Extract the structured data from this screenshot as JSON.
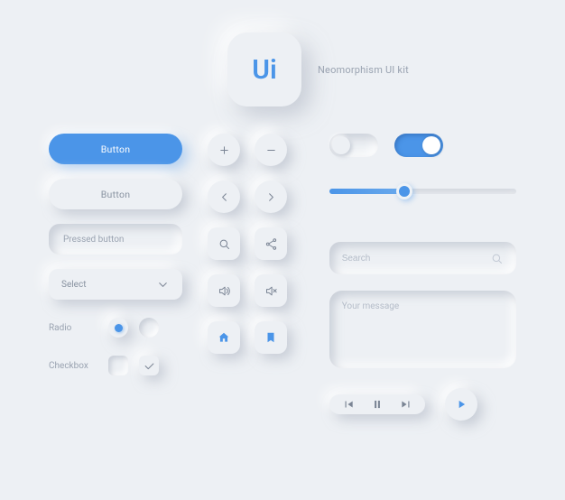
{
  "header": {
    "logo_text": "Ui",
    "title": "Neomorphism UI kit"
  },
  "buttons": {
    "primary_label": "Button",
    "default_label": "Button",
    "pressed_label": "Pressed button",
    "select_label": "Select"
  },
  "options": {
    "radio_label": "Radio",
    "checkbox_label": "Checkbox",
    "radio_selected_index": 0,
    "checkbox_checked_index": 1
  },
  "toggles": {
    "left_on": false,
    "right_on": true
  },
  "slider": {
    "percent": 40
  },
  "search": {
    "placeholder": "Search",
    "value": ""
  },
  "message": {
    "placeholder": "Your message",
    "value": ""
  },
  "icons": {
    "plus": "plus-icon",
    "minus": "minus-icon",
    "chev_left": "chevron-left-icon",
    "chev_right": "chevron-right-icon",
    "search": "search-icon",
    "share": "share-icon",
    "volume": "volume-icon",
    "mute": "mute-icon",
    "home": "home-icon",
    "bookmark": "bookmark-icon",
    "prev": "skip-previous-icon",
    "pause": "pause-icon",
    "next": "skip-next-icon",
    "play": "play-icon",
    "chev_down": "chevron-down-icon"
  },
  "colors": {
    "accent": "#4b95e8",
    "surface": "#edf0f4",
    "text_muted": "#9aa3b1"
  }
}
